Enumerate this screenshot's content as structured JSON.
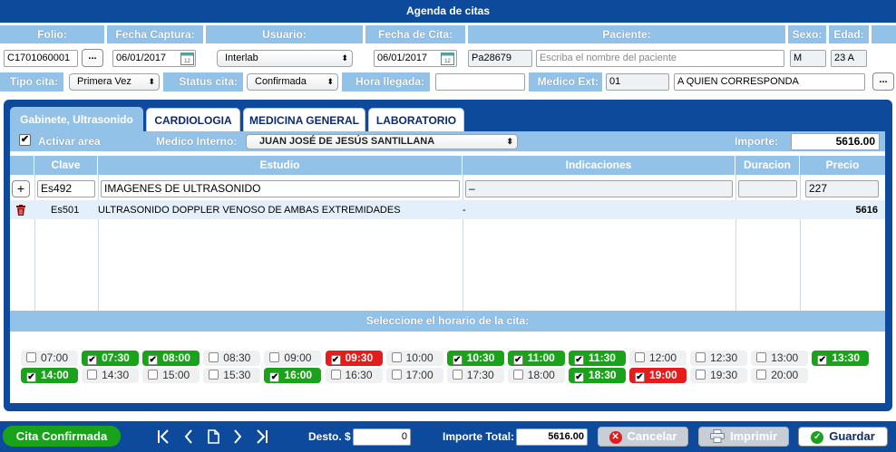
{
  "title": "Agenda de citas",
  "header": {
    "folio_label": "Folio:",
    "fecha_captura_label": "Fecha Captura:",
    "usuario_label": "Usuario:",
    "fecha_cita_label": "Fecha de Cita:",
    "paciente_label": "Paciente:",
    "sexo_label": "Sexo:",
    "edad_label": "Edad:"
  },
  "fields": {
    "folio": "C1701060001",
    "fecha_captura": "06/01/2017",
    "usuario": "Interlab",
    "fecha_cita": "06/01/2017",
    "paciente_id": "Pa28679",
    "paciente_placeholder": "Escriba el nombre del paciente",
    "sexo": "M",
    "edad": "23 A",
    "ellipsis": "..."
  },
  "row2": {
    "tipo_cita_label": "Tipo cita:",
    "tipo_cita": "Primera Vez",
    "status_cita_label": "Status cita:",
    "status_cita": "Confirmada",
    "hora_llegada_label": "Hora llegada:",
    "hora_llegada": "",
    "medico_ext_label": "Medico Ext:",
    "medico_ext_code": "01",
    "medico_ext_name": "A QUIEN CORRESPONDA"
  },
  "tabs": [
    {
      "label": "Gabinete, Ultrasonido",
      "active": true
    },
    {
      "label": "CARDIOLOGIA"
    },
    {
      "label": "MEDICINA GENERAL"
    },
    {
      "label": "LABORATORIO"
    }
  ],
  "area": {
    "activar_label": "Activar area",
    "activar_checked": true,
    "medico_interno_label": "Medico Interno:",
    "medico_interno": "JUAN JOSÉ DE JESÚS SANTILLANA",
    "importe_label": "Importe:",
    "importe": "5616.00"
  },
  "table": {
    "columns": [
      "Clave",
      "Estudio",
      "Indicaciones",
      "Duracion",
      "Precio"
    ],
    "input_row": {
      "add": "+",
      "clave": "Es492",
      "estudio": "IMAGENES DE ULTRASONIDO",
      "indicaciones": "–",
      "duracion": "",
      "precio": "227"
    },
    "rows": [
      {
        "clave": "Es501",
        "estudio": "ULTRASONIDO DOPPLER VENOSO DE AMBAS EXTREMIDADES",
        "indicaciones": "-",
        "duracion": "",
        "precio": "5616"
      }
    ]
  },
  "schedule": {
    "title": "Seleccione el horario de la cita:",
    "slots": [
      {
        "time": "07:00",
        "checked": false,
        "state": "free"
      },
      {
        "time": "07:30",
        "checked": true,
        "state": "green"
      },
      {
        "time": "08:00",
        "checked": true,
        "state": "green"
      },
      {
        "time": "08:30",
        "checked": false,
        "state": "free"
      },
      {
        "time": "09:00",
        "checked": false,
        "state": "free"
      },
      {
        "time": "09:30",
        "checked": true,
        "state": "red"
      },
      {
        "time": "10:00",
        "checked": false,
        "state": "free"
      },
      {
        "time": "10:30",
        "checked": true,
        "state": "green"
      },
      {
        "time": "11:00",
        "checked": true,
        "state": "green"
      },
      {
        "time": "11:30",
        "checked": true,
        "state": "green"
      },
      {
        "time": "12:00",
        "checked": false,
        "state": "free"
      },
      {
        "time": "12:30",
        "checked": false,
        "state": "free"
      },
      {
        "time": "13:00",
        "checked": false,
        "state": "free"
      },
      {
        "time": "13:30",
        "checked": true,
        "state": "green"
      },
      {
        "time": "14:00",
        "checked": true,
        "state": "green"
      },
      {
        "time": "14:30",
        "checked": false,
        "state": "free"
      },
      {
        "time": "15:00",
        "checked": false,
        "state": "free"
      },
      {
        "time": "15:30",
        "checked": false,
        "state": "free"
      },
      {
        "time": "16:00",
        "checked": true,
        "state": "green"
      },
      {
        "time": "16:30",
        "checked": false,
        "state": "free"
      },
      {
        "time": "17:00",
        "checked": false,
        "state": "free"
      },
      {
        "time": "17:30",
        "checked": false,
        "state": "free"
      },
      {
        "time": "18:00",
        "checked": false,
        "state": "free"
      },
      {
        "time": "18:30",
        "checked": true,
        "state": "green"
      },
      {
        "time": "19:00",
        "checked": true,
        "state": "red"
      },
      {
        "time": "19:30",
        "checked": false,
        "state": "free"
      },
      {
        "time": "20:00",
        "checked": false,
        "state": "free"
      }
    ]
  },
  "footer": {
    "status": "Cita Confirmada",
    "desto_label": "Desto. $",
    "desto": "0",
    "importe_total_label": "Importe Total:",
    "importe_total": "5616.00",
    "cancelar": "Cancelar",
    "imprimir": "Imprimir",
    "guardar": "Guardar"
  },
  "colors": {
    "brand_blue": "#0d4a9c",
    "header_blue": "#93c2e9",
    "slot_green": "#1aa31a",
    "slot_red": "#e51c1c",
    "status_green": "#1aa31a"
  }
}
